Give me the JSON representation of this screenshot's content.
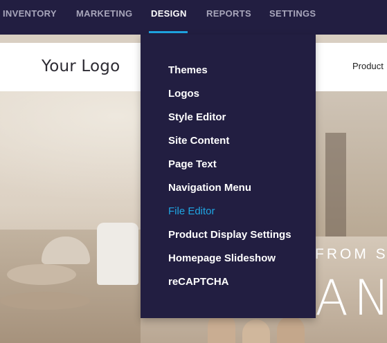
{
  "topnav": {
    "items": [
      {
        "label": "INVENTORY",
        "active": false
      },
      {
        "label": "MARKETING",
        "active": false
      },
      {
        "label": "DESIGN",
        "active": true
      },
      {
        "label": "REPORTS",
        "active": false
      },
      {
        "label": "SETTINGS",
        "active": false
      }
    ]
  },
  "store_header": {
    "logo_text": "Your Logo",
    "nav_link": "Product"
  },
  "hero": {
    "line1": "FROM S",
    "line2": "AND"
  },
  "design_menu": {
    "items": [
      {
        "label": "Themes"
      },
      {
        "label": "Logos"
      },
      {
        "label": "Style Editor"
      },
      {
        "label": "Site Content"
      },
      {
        "label": "Page Text"
      },
      {
        "label": "Navigation Menu"
      },
      {
        "label": "File Editor",
        "hovered": true
      },
      {
        "label": "Product Display Settings"
      },
      {
        "label": "Homepage Slideshow"
      },
      {
        "label": "reCAPTCHA"
      }
    ]
  },
  "colors": {
    "nav_bg": "#221e41",
    "nav_text": "#a8a6bb",
    "active_text": "#ffffff",
    "accent": "#1fa5e3"
  }
}
